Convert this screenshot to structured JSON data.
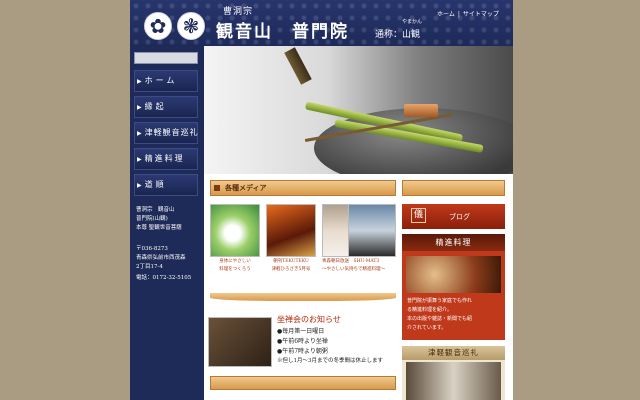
{
  "header": {
    "sect": "曹洞宗",
    "temple_name": "観音山　普門院",
    "alias_label": "通称：山観",
    "alias_ruby": "やまかん",
    "top_nav": [
      "ホーム",
      "サイトマップ"
    ],
    "crest_icons": [
      "lotus-crest-icon",
      "snowflake-crest-icon"
    ]
  },
  "sidebar": {
    "nav": [
      "ホーム",
      "縁起",
      "津軽観音巡礼",
      "精進料理",
      "道順"
    ],
    "address": [
      "曹洞宗　観音山",
      "普門院(山観)",
      "本尊 聖観世音菩薩",
      "〒036-8273",
      "青森県弘前市西茂森",
      "2丁目17-4",
      "電話：0172-32-5105"
    ]
  },
  "media": {
    "title": "各種メディア",
    "items": [
      {
        "caption1": "身体にやさしい",
        "caption2": "料理をつくろう"
      },
      {
        "caption1": "朝刊TEKUTEKU",
        "caption2": "津軽ひろさき5月号"
      },
      {
        "caption1": "青森朝日放送　SHU-MAT3",
        "caption2": "〜やさしい気持ちで精進料理〜"
      },
      {
        "caption1": "",
        "caption2": ""
      }
    ]
  },
  "zazen": {
    "title": "坐禅会のお知らせ",
    "lines": [
      "●毎月第一日曜日",
      "●午前6時より坐禅",
      "●午前7時より朝粥",
      "※但し1月〜3月までの冬季間は休止します"
    ]
  },
  "right": {
    "blog_label": "ブログ",
    "blog_icon_char": "儀",
    "shojin_title": "精進料理",
    "shojin_desc": [
      "普門院が振舞う家庭でも作れ",
      "る精進料理を紹介。",
      "本の出版や雑誌・新聞でも紹",
      "介されています。"
    ],
    "pilgrim_title": "津軽観音巡礼"
  },
  "colors": {
    "navy": "#1e2a57",
    "accent_red": "#c0391b",
    "wood": "#d79a4c",
    "background": "#a99c83"
  }
}
